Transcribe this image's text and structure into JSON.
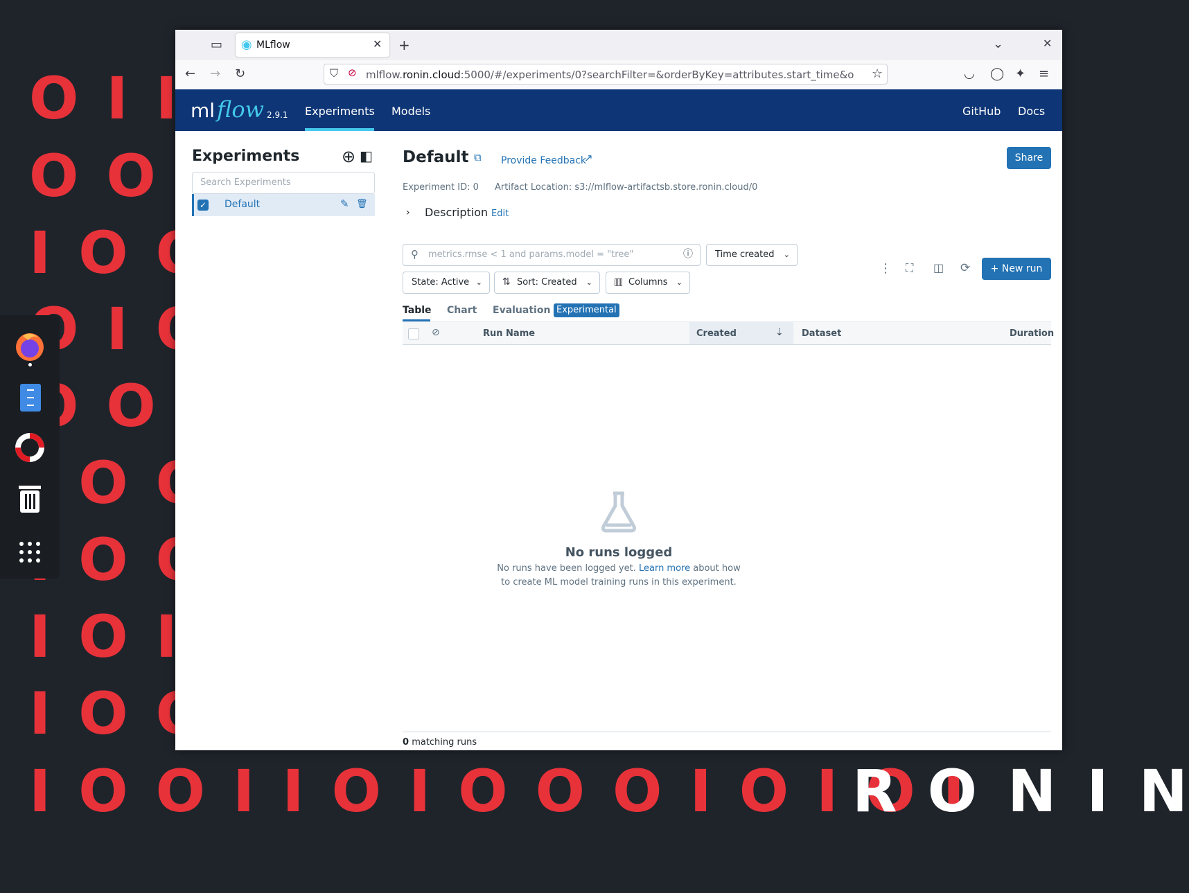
{
  "wallpaper": {
    "rows": [
      "OIIOOIOIIO",
      "OOIOOIOIIOIIO",
      "IOOOIOIIIOOIO",
      "OIOOIOIOIIOO",
      "OOIOIOIOIOOIO",
      "IOOIOIOIIOIOII",
      "IOOOIOIOIIO",
      "IOIOIIIIOOIIIOII",
      "IOOOIIOIOIOIIO"
    ],
    "bottom_row": "IOOIIOIOOOIOIOI",
    "brand": "RONIN"
  },
  "dock": {
    "items": [
      "firefox-icon",
      "files-icon",
      "help-icon",
      "trash-icon",
      "apps-grid-icon"
    ]
  },
  "browser": {
    "tab_title": "MLflow",
    "url_host": "mlflow.",
    "url_domain": "ronin.cloud",
    "url_rest": ":5000/#/experiments/0?searchFilter=&orderByKey=attributes.start_time&o"
  },
  "header": {
    "logo_ml": "ml",
    "logo_flow": "flow",
    "version": "2.9.1",
    "nav": [
      "Experiments",
      "Models"
    ],
    "right": [
      "GitHub",
      "Docs"
    ]
  },
  "sidebar": {
    "title": "Experiments",
    "search_placeholder": "Search Experiments",
    "items": [
      {
        "label": "Default"
      }
    ]
  },
  "experiment": {
    "title": "Default",
    "feedback": "Provide Feedback",
    "share": "Share",
    "id_text": "Experiment ID: 0",
    "artifact_text": "Artifact Location: s3://mlflow-artifactsb.store.ronin.cloud/0",
    "description_label": "Description",
    "description_edit": "Edit"
  },
  "controls": {
    "search_placeholder": "metrics.rmse < 1 and params.model = \"tree\"",
    "time_created": "Time created",
    "state": "State: Active",
    "sort": "Sort: Created",
    "columns": "Columns",
    "new_run": "New run"
  },
  "view_tabs": {
    "items": [
      "Table",
      "Chart",
      "Evaluation"
    ],
    "badge": "Experimental"
  },
  "table": {
    "columns": [
      "Run Name",
      "Created",
      "Dataset",
      "Duration"
    ]
  },
  "empty": {
    "title": "No runs logged",
    "line1_pre": "No runs have been logged yet.",
    "line1_link": "Learn more",
    "line1_post": "about how",
    "line2": "to create ML model training runs in this experiment."
  },
  "footer": {
    "count": "0",
    "label": "matching runs"
  },
  "colors": {
    "header_bg": "#0e3576",
    "accent": "#2272b4",
    "logo_flow": "#43c9ed",
    "wallpaper_red": "#e8323a"
  }
}
